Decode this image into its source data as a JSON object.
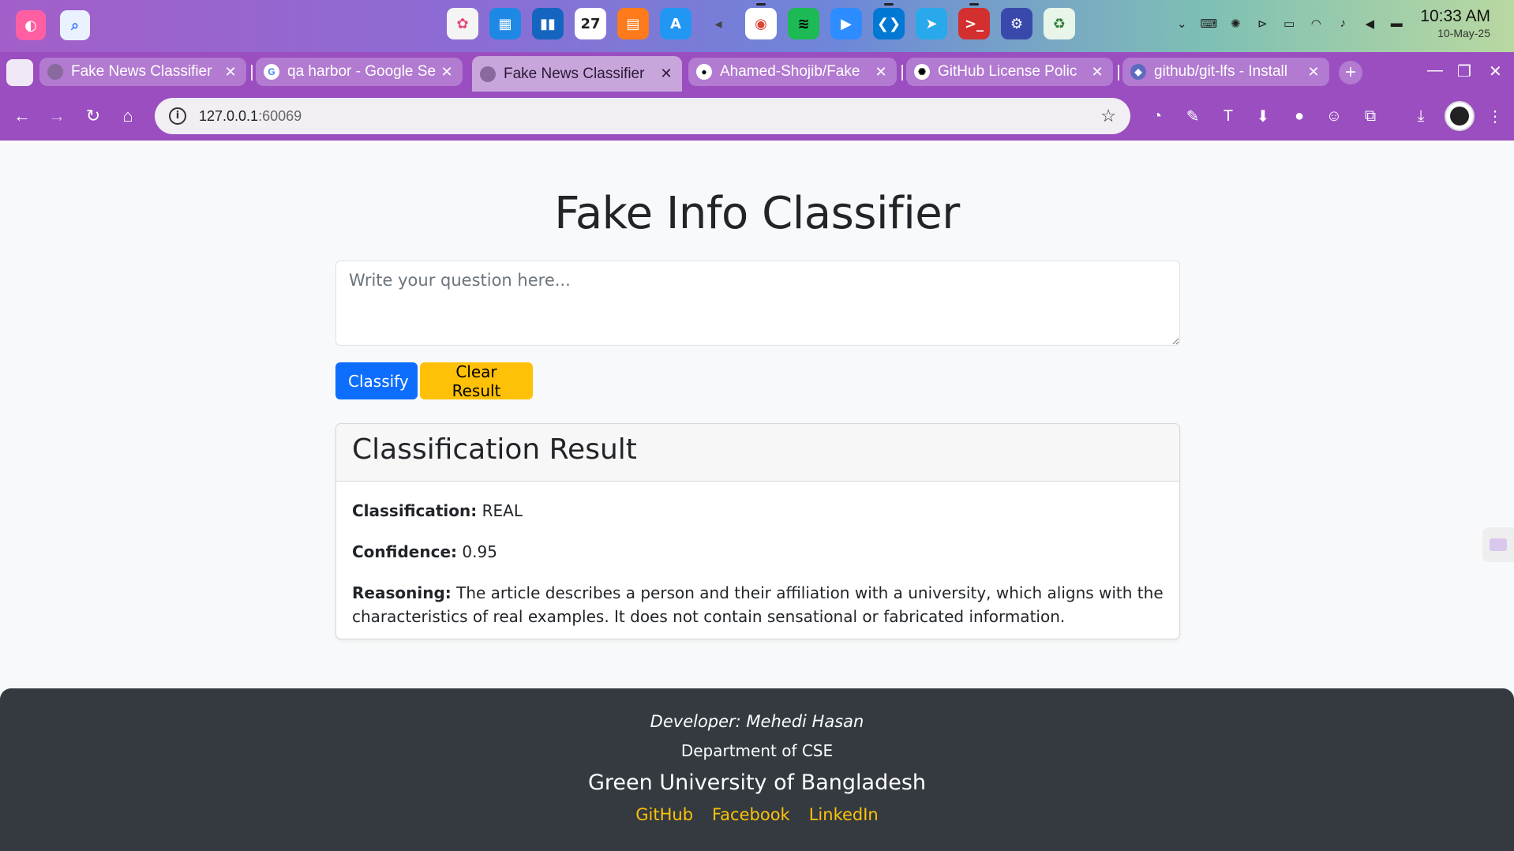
{
  "os": {
    "left_apps": [
      {
        "name": "launcher-app-icon",
        "glyph": "◐",
        "color": "#ff5fa2"
      },
      {
        "name": "search-app-icon",
        "glyph": "⌕",
        "color": "#3a7bff"
      }
    ],
    "dock": [
      {
        "name": "pinwheel-app-icon",
        "glyph": "✿",
        "color": "#f4f4f4",
        "fg": "#e64a7a"
      },
      {
        "name": "calculator-app-icon",
        "glyph": "▦",
        "color": "#1e88e5"
      },
      {
        "name": "trello-app-icon",
        "glyph": "▮▮",
        "color": "#1565c0"
      },
      {
        "name": "calendar-app-icon",
        "glyph": "27",
        "color": "#ffffff",
        "fg": "#222"
      },
      {
        "name": "archive-app-icon",
        "glyph": "▤",
        "color": "#ff7a1a"
      },
      {
        "name": "store-app-icon",
        "glyph": "A",
        "color": "#2196f3"
      },
      {
        "name": "volume-app-icon",
        "glyph": "◂",
        "color": "transparent",
        "fg": "#444"
      },
      {
        "name": "chrome-app-icon",
        "glyph": "◉",
        "color": "#ffffff",
        "fg": "#db4437",
        "running": true
      },
      {
        "name": "spotify-app-icon",
        "glyph": "≋",
        "color": "#1db954",
        "fg": "#000"
      },
      {
        "name": "zoom-app-icon",
        "glyph": "▶",
        "color": "#2d8cff"
      },
      {
        "name": "vscode-app-icon",
        "glyph": "❮❯",
        "color": "#0078d4",
        "running": true
      },
      {
        "name": "telegram-app-icon",
        "glyph": "➤",
        "color": "#29a9eb"
      },
      {
        "name": "terminal-app-icon",
        "glyph": ">_",
        "color": "#d32f2f",
        "running": true
      },
      {
        "name": "settings-app-icon",
        "glyph": "⚙",
        "color": "#3949ab"
      },
      {
        "name": "trash-app-icon",
        "glyph": "♻",
        "color": "#e8f5e9",
        "fg": "#2e7d32"
      }
    ],
    "tray_icons": [
      "chevron-down-icon",
      "keyboard-icon",
      "openai-icon",
      "media-play-icon",
      "battery-icon",
      "wifi-icon",
      "bell-icon",
      "speaker-icon",
      "power-icon"
    ],
    "time": "10:33 AM",
    "date": "10-May-25"
  },
  "browser": {
    "tabs": [
      {
        "title": "Fake News Classifier",
        "favicon": "globe-icon",
        "active": false
      },
      {
        "title": "qa harbor - Google Se",
        "favicon": "google-icon",
        "active": false
      },
      {
        "title": "Fake News Classifier",
        "favicon": "globe-icon",
        "active": true
      },
      {
        "title": "Ahamed-Shojib/Fake",
        "favicon": "github-icon",
        "active": false
      },
      {
        "title": "GitHub License Polic",
        "favicon": "openai-icon",
        "active": false
      },
      {
        "title": "github/git-lfs - Install",
        "favicon": "git-lfs-icon",
        "active": false
      }
    ],
    "url_host": "127.0.0.1",
    "url_port": ":60069",
    "extensions": [
      "whatsapp-icon",
      "eyedropper-icon",
      "translate-icon",
      "download-ext-icon",
      "cookie-icon",
      "emoji-ext-icon",
      "puzzle-icon",
      "downloads-icon"
    ]
  },
  "page": {
    "title": "Fake Info Classifier",
    "question_placeholder": "Write your question here...",
    "question_value": "",
    "classify_label": "Classify",
    "clear_label": "Clear Result",
    "result": {
      "header": "Classification Result",
      "classification_label": "Classification:",
      "classification_value": "REAL",
      "confidence_label": "Confidence:",
      "confidence_value": "0.95",
      "reasoning_label": "Reasoning:",
      "reasoning_value": "The article describes a person and their affiliation with a university, which aligns with the characteristics of real examples. It does not contain sensational or fabricated information."
    },
    "footer": {
      "developer": "Developer: Mehedi Hasan",
      "department": "Department of CSE",
      "university": "Green University of Bangladesh",
      "links": [
        "GitHub",
        "Facebook",
        "LinkedIn"
      ]
    }
  },
  "colors": {
    "primary": "#0d6efd",
    "warning": "#ffc107",
    "footer_bg": "#343a40",
    "browser_chrome": "#9a4ec0"
  }
}
